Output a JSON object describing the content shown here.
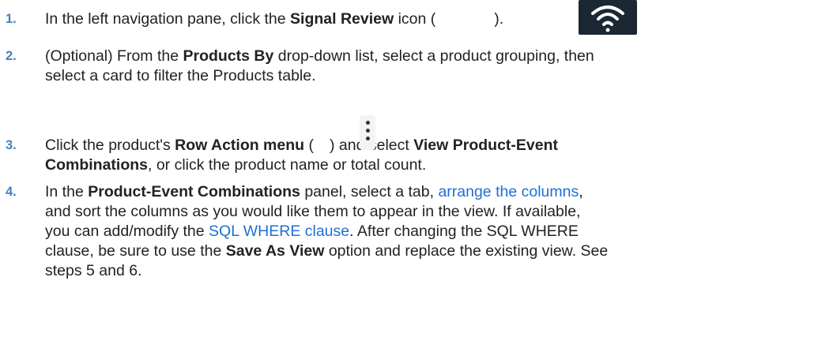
{
  "steps": [
    {
      "number": "1.",
      "lines": [
        {
          "t1": "In the left navigation pane, click the ",
          "b1": "Signal Review",
          "t2": " icon (",
          "t3": ")."
        }
      ],
      "icon": "wifi-icon"
    },
    {
      "number": "2.",
      "line1": {
        "t1": "(Optional) From the ",
        "b1": "Products By",
        "t2": " drop-down list, select a product grouping, then"
      },
      "line2": "select a card to filter the Products table."
    },
    {
      "number": "3.",
      "line1": {
        "t1": "Click the product's ",
        "b1": "Row Action menu",
        "t2": " (",
        "t3": ") and select ",
        "b2": "View Product-Event"
      },
      "line2": {
        "b1": "Combinations",
        "t1": ", or click the product name or total count."
      },
      "icon": "kebab-icon"
    },
    {
      "number": "4.",
      "line1": {
        "t1": "In the ",
        "b1": "Product-Event Combinations",
        "t2": " panel, select a tab, ",
        "link1": "arrange the columns",
        "t3": ","
      },
      "line2": "and sort the columns as you would like them to appear in the view. If available,",
      "line3": {
        "t1": "you can add/modify the ",
        "link1": "SQL WHERE clause",
        "t2": ". After changing the SQL WHERE"
      },
      "line4": {
        "t1": "clause, be sure to use the ",
        "b1": "Save As View",
        "t2": " option and replace the existing view. See"
      },
      "line5": "steps 5 and 6."
    }
  ]
}
